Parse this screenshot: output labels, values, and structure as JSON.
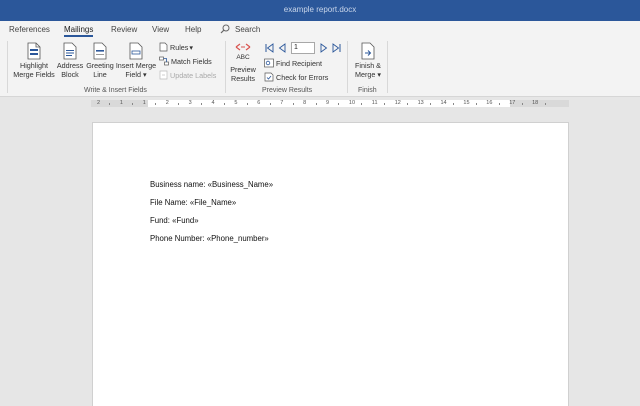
{
  "window": {
    "title": "example report.docx"
  },
  "tabs": [
    {
      "label": "References",
      "active": false
    },
    {
      "label": "Mailings",
      "active": true
    },
    {
      "label": "Review",
      "active": false
    },
    {
      "label": "View",
      "active": false
    },
    {
      "label": "Help",
      "active": false
    }
  ],
  "search": {
    "label": "Search"
  },
  "ribbon": {
    "write_insert": {
      "highlight_merge_fields": "Highlight Merge Fields",
      "address_block": "Address Block",
      "greeting_line": "Greeting Line",
      "insert_merge_field": "Insert Merge Field",
      "rules": "Rules",
      "match_fields": "Match Fields",
      "update_labels": "Update Labels",
      "group_label": "Write & Insert Fields"
    },
    "preview": {
      "preview_results": "Preview Results",
      "abc_label": "ABC",
      "record_value": "1",
      "find_recipient": "Find Recipient",
      "check_for_errors": "Check for Errors",
      "group_label": "Preview Results"
    },
    "finish": {
      "finish_merge": "Finish & Merge",
      "group_label": "Finish"
    }
  },
  "document": {
    "lines": [
      "Business name: «Business_Name»",
      "File Name: «File_Name»",
      "Fund: «Fund»",
      "Phone Number: «Phone_number»"
    ]
  },
  "ruler": {
    "numbers": [
      "2",
      "1",
      "1",
      "2",
      "3",
      "4",
      "5",
      "6",
      "7",
      "8",
      "9",
      "10",
      "11",
      "12",
      "13",
      "14",
      "15",
      "16",
      "17",
      "18"
    ]
  },
  "colors": {
    "titlebar": "#2b579a",
    "accent": "#2b579a",
    "preview_red": "#d9534f"
  }
}
